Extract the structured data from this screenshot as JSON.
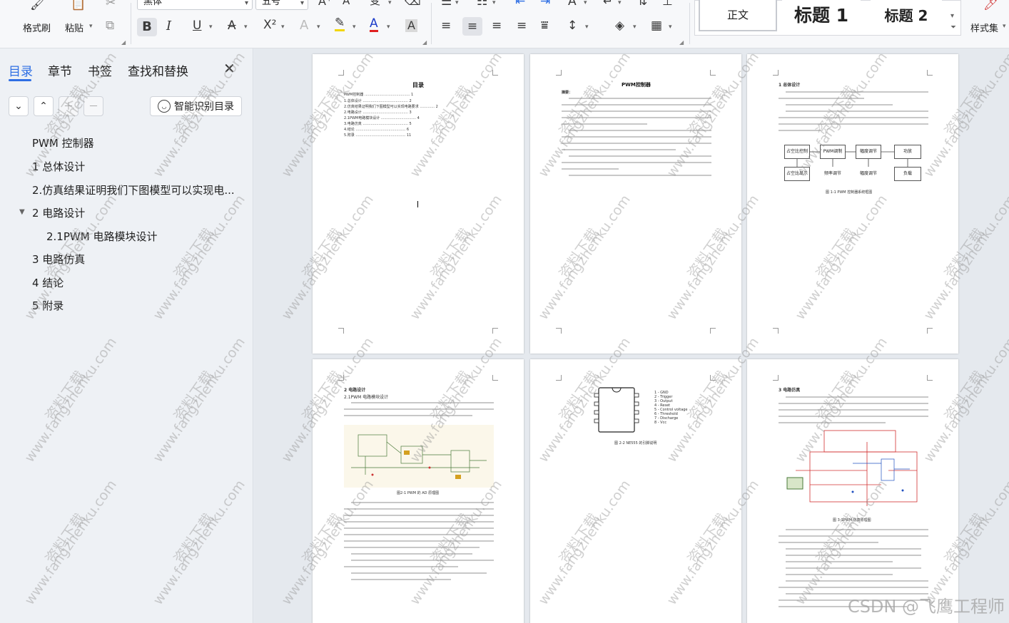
{
  "ribbon": {
    "format_painter": "格式刷",
    "paste": "粘贴",
    "font_name": "黑体",
    "font_size": "五号",
    "bold": "B",
    "italic": "I",
    "underline": "U",
    "strike": "A",
    "superscript": "X²",
    "highlight": "A",
    "font_color": "A",
    "char_shading": "A",
    "styles": {
      "normal": "正文",
      "heading1": "标题 1",
      "heading2": "标题 2"
    },
    "style_set": "样式集"
  },
  "nav": {
    "tabs": [
      "目录",
      "章节",
      "书签",
      "查找和替换"
    ],
    "ai_button": "智能识别目录",
    "toc": [
      "PWM 控制器",
      "1 总体设计",
      "2.仿真结果证明我们下图模型可以实现电...",
      "2 电路设计",
      "2.1PWM 电路模块设计",
      "3 电路仿真",
      "4 结论",
      "5 附录"
    ]
  },
  "pages": {
    "p1": {
      "title": "目录",
      "lines": [
        "PWM控制器 ........................................ 1",
        "1.总体设计 ........................................ 2",
        "2.仿真结果证明我们下图模型可以实现电路要求 ............. 2",
        "2.电路设计 ........................................ 3",
        "  2.1PWM电路模块设计 ............................... 4",
        "3.电路仿真 ........................................ 5",
        "4.结论 ............................................ 6",
        "5.附录 ............................................ 11"
      ]
    },
    "p2": {
      "title": "PWM控制器",
      "abstract_label": "摘要："
    },
    "p3": {
      "heading": "1 总体设计",
      "blocks": [
        "占空比控制",
        "PWM调制",
        "幅度调节",
        "功放",
        "占空比显示",
        "频率调节",
        "幅度调节",
        "负载"
      ],
      "caption": "图 1-1 PWM 控制器系统框图"
    },
    "p4": {
      "heading": "2 电路设计",
      "sub": "2.1PWM 电路模块设计",
      "caption": "图2-1 PWM 的 AD 原理图"
    },
    "p5": {
      "pins": [
        "1 - GND",
        "2 - Trigger",
        "3 - Output",
        "4 - Reset",
        "5 - Control voltage",
        "6 - Threshold",
        "7 - Discharge",
        "8 - Vcc"
      ],
      "caption": "图 2-2 NE555 的引脚说明"
    },
    "p6": {
      "heading": "3 电路仿真",
      "caption": "图 3-1PWM 仿真原理图"
    }
  },
  "watermark": {
    "cn": "资料下载",
    "url": "www.fangzhenku.com"
  },
  "corner_watermark": "CSDN @飞鹰工程师"
}
